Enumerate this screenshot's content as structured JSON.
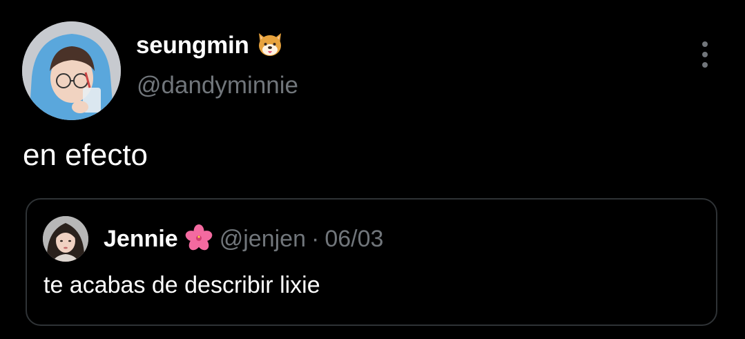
{
  "tweet": {
    "author": {
      "display_name": "seungmin",
      "name_emoji": "dog-face-emoji",
      "handle": "@dandyminnie",
      "avatar": "avatar-photo"
    },
    "text": "en efecto",
    "more_icon": "vertical-ellipsis-icon"
  },
  "quoted_tweet": {
    "author": {
      "display_name": "Jennie",
      "name_emoji": "hibiscus-emoji",
      "handle": "@jenjen",
      "avatar": "avatar-photo"
    },
    "separator": "·",
    "date": "06/03",
    "text": "te acabas de describir lixie"
  },
  "colors": {
    "background": "#000000",
    "primary_text": "#ffffff",
    "secondary_text": "#71767b",
    "border": "#2f3336"
  }
}
